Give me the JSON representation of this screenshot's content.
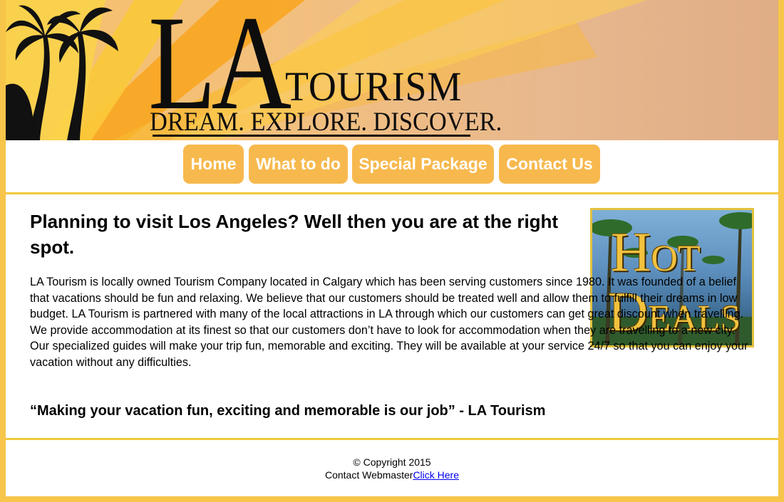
{
  "brand": {
    "logo_main": "LA",
    "logo_sub": "TOURISM",
    "tagline": "DREAM. EXPLORE. DISCOVER."
  },
  "nav": {
    "items": [
      {
        "label": "Home"
      },
      {
        "label": "What to do"
      },
      {
        "label": "Special Package"
      },
      {
        "label": "Contact Us"
      }
    ]
  },
  "main": {
    "heading": "Planning to visit Los Angeles? Well then you are at the right spot.",
    "body": "LA Tourism is locally owned Tourism Company located in Calgary which has been serving customers since 1980. It was founded of a belief that vacations should be fun and relaxing. We believe that our customers should be treated well and allow them to fulfill their dreams in low budget. LA Tourism is partnered with many of the local attractions in LA through which our customers can get great discount when travelling. We provide accommodation at its finest so that our customers don’t have to look for accommodation when they are travelling to a new city. Our specialized guides will make your trip fun, memorable and exciting. They will be available at your service 24/7 so that you can enjoy your vacation without any difficulties.",
    "quote": "“Making your vacation fun, exciting and memorable is our job” - LA Tourism",
    "promo": {
      "line1_cap": "H",
      "line1_rest": "OT",
      "line2_cap": "D",
      "line2_rest": "EALS"
    }
  },
  "footer": {
    "copyright": "© Copyright 2015",
    "contact_text": "Contact Webmaster",
    "contact_link": "Click Here"
  },
  "colors": {
    "accent": "#f7b94e",
    "border": "#f7c54a",
    "divider": "#f0c83a"
  }
}
